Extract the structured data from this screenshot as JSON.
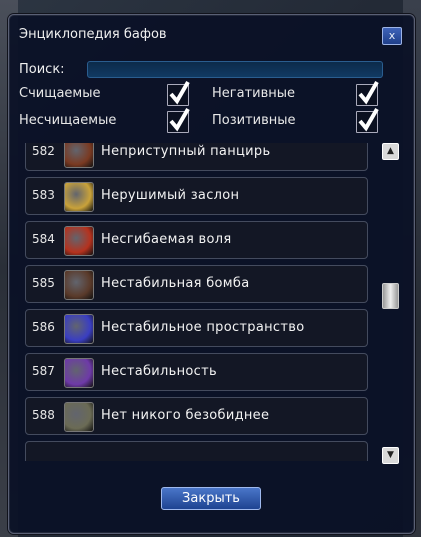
{
  "window": {
    "title": "Энциклопедия бафов",
    "close_glyph": "x",
    "close_button_label": "Закрыть"
  },
  "search": {
    "label": "Поиск:",
    "value": ""
  },
  "filters": [
    {
      "label": "Счищаемые",
      "checked": true
    },
    {
      "label": "Негативные",
      "checked": true
    },
    {
      "label": "Несчищаемые",
      "checked": true
    },
    {
      "label": "Позитивные",
      "checked": true
    }
  ],
  "buffs": [
    {
      "num": "582",
      "name": "Неприступный панцирь",
      "icon": "armor-icon",
      "color": "#7a3a22"
    },
    {
      "num": "583",
      "name": "Нерушимый заслон",
      "icon": "shield-icon",
      "color": "#c9a23a"
    },
    {
      "num": "584",
      "name": "Несгибаемая воля",
      "icon": "fire-slash-icon",
      "color": "#b5321e"
    },
    {
      "num": "585",
      "name": "Нестабильная бомба",
      "icon": "bomb-icon",
      "color": "#5a3a2a"
    },
    {
      "num": "586",
      "name": "Нестабильное пространство",
      "icon": "void-icon",
      "color": "#3a3ec2"
    },
    {
      "num": "587",
      "name": "Нестабильность",
      "icon": "skull-icon",
      "color": "#6e3aa8"
    },
    {
      "num": "588",
      "name": "Нет никого безобиднее",
      "icon": "cat-icon",
      "color": "#6b6b55"
    }
  ],
  "scrollbar": {
    "up_glyph": "▲",
    "down_glyph": "▼"
  }
}
